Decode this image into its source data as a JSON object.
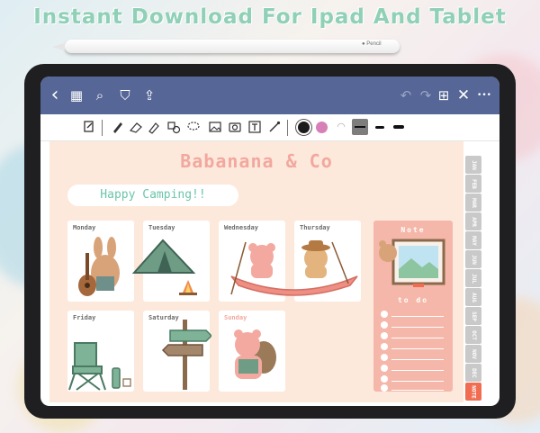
{
  "headline": "Instant Download For Ipad And Tablet",
  "pencil_brand": "Pencil",
  "topbar": {
    "icons": [
      "back-icon",
      "grid-icon",
      "search-icon",
      "bookmark-icon",
      "share-icon",
      "undo-icon",
      "redo-icon",
      "add-page-icon",
      "close-icon",
      "more-icon"
    ],
    "glyphs": {
      "back": "‹",
      "grid": "▦",
      "search": "⌕",
      "bookmark": "⛉",
      "share": "⇪",
      "undo": "↶",
      "redo": "↷",
      "add_page": "⊞",
      "close": "✕",
      "more": "•••"
    }
  },
  "toolbar": {
    "tools": [
      "lasso-select-icon",
      "pen-icon",
      "eraser-icon",
      "highlighter-icon",
      "shapes-icon",
      "lasso-icon",
      "image-icon",
      "camera-icon",
      "text-icon",
      "laser-icon"
    ],
    "colors": {
      "black": "#1b1b1b",
      "pink": "#d77fb7",
      "stroke_box": "#7d7d7d"
    }
  },
  "planner": {
    "brand": "Babanana & Co",
    "banner": "Happy Camping!!",
    "days": [
      "Monday",
      "Tuesday",
      "Wednesday",
      "Thursday",
      "Friday",
      "Saturday",
      "Sunday"
    ],
    "note_label": "Note",
    "todo_label": "to do",
    "todo_count": 8
  },
  "month_tabs": [
    "JAN",
    "FEB",
    "MAR",
    "APR",
    "MAY",
    "JUN",
    "JUL",
    "AUG",
    "SEP",
    "OCT",
    "NOV",
    "DEC",
    "NOTE"
  ],
  "colors": {
    "topbar": "#556697",
    "page_bg": "#fde9dc",
    "brand": "#f2a89e",
    "banner_text": "#6cc5a9",
    "side_panel": "#f5b7a9",
    "tab_grey": "#c9c9c9",
    "tab_note": "#f06d52",
    "headline": "#8fd0b7"
  }
}
